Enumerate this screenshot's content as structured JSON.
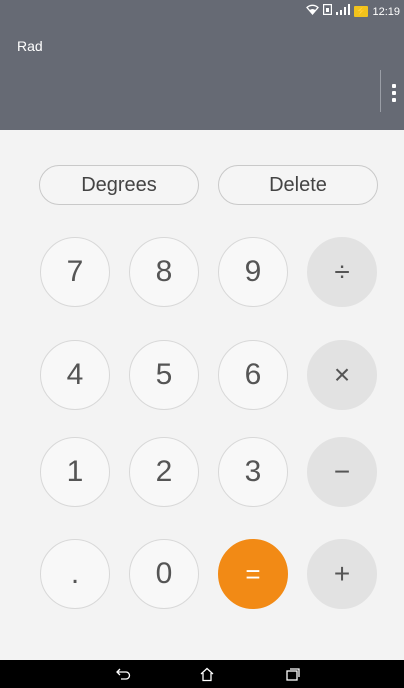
{
  "status_bar": {
    "wifi_icon": "wifi-icon",
    "sim_icon": "sim-icon",
    "signal_icon": "signal-icon",
    "battery_icon": "battery-charging-icon",
    "time": "12:19"
  },
  "display": {
    "angle_mode": "Rad",
    "menu_icon": "overflow-menu-icon"
  },
  "pills": {
    "degrees": "Degrees",
    "delete": "Delete"
  },
  "keys": {
    "seven": "7",
    "eight": "8",
    "nine": "9",
    "divide": "÷",
    "four": "4",
    "five": "5",
    "six": "6",
    "multiply": "×",
    "one": "1",
    "two": "2",
    "three": "3",
    "minus": "−",
    "dot": ".",
    "zero": "0",
    "equals": "=",
    "plus": "+"
  },
  "colors": {
    "header_bg": "#666a74",
    "equals_bg": "#f28a15",
    "operator_bg": "#e2e2e2",
    "pad_bg": "#f3f3f3"
  },
  "nav_bar": {
    "back_icon": "back-icon",
    "home_icon": "home-icon",
    "recents_icon": "recents-icon"
  }
}
